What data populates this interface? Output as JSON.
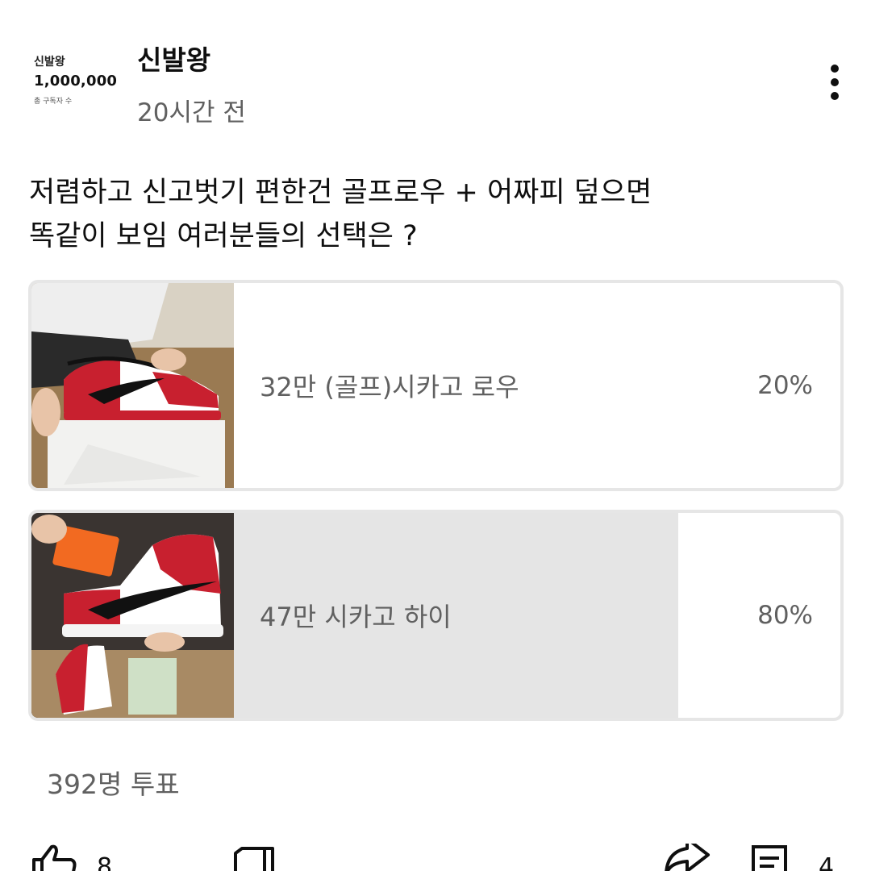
{
  "channel": {
    "avatar_name": "신발왕",
    "avatar_subscribers": "1,000,000",
    "avatar_caption": "총 구독자 수",
    "name": "신발왕",
    "posted": "20시간 전"
  },
  "post": {
    "text_line1": "저렴하고 신고벗기 편한건 골프로우 + 어짜피 덮으면",
    "text_line2": "똑같이 보임 여러분들의 선택은 ?"
  },
  "poll": {
    "options": [
      {
        "label": "32만 (골프)시카고 로우",
        "percent_label": "20%",
        "percent": 20,
        "image_icon": "golf-low-sneaker-image"
      },
      {
        "label": "47만 시카고 하이",
        "percent_label": "80%",
        "percent": 80,
        "image_icon": "high-top-sneaker-image"
      }
    ],
    "vote_count": "392명 투표"
  },
  "actions": {
    "like_count": "8",
    "comment_count": "4",
    "icons": [
      "thumbs-up-icon",
      "thumbs-down-icon",
      "share-icon",
      "comment-icon"
    ]
  },
  "colors": {
    "fill": "#e5e5e5",
    "border": "#e6e6e6",
    "text_secondary": "#606060",
    "sneaker_red": "#c8202f"
  }
}
